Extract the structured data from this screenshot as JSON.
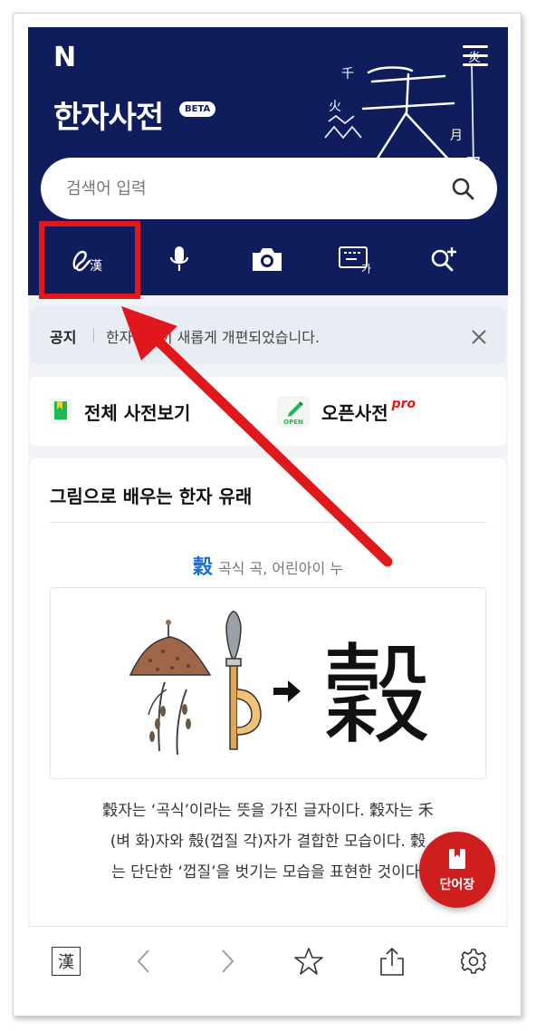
{
  "header": {
    "logo": "N",
    "title": "한자사전",
    "beta": "BETA"
  },
  "search": {
    "placeholder": "검색어 입력"
  },
  "tools": [
    "handwriting-hanja",
    "voice",
    "camera",
    "keyboard-hanja",
    "advanced-search"
  ],
  "tool_hanja_glyph": "漢",
  "tool_keyboard_glyph": "가",
  "notice": {
    "label": "공지",
    "text": "한자사전이 새롭게 개편되었습니다."
  },
  "links": {
    "all_dict": "전체 사전보기",
    "open_dict": "오픈사전",
    "pro": "pro",
    "open_badge": "OPEN"
  },
  "card": {
    "title": "그림으로 배우는 한자 유래",
    "char": "穀",
    "char_meaning": "곡식 곡, 어린아이 누",
    "big_char": "穀",
    "desc_lines": [
      "穀자는 ‘곡식’이라는 뜻을 가진 글자이다. 穀자는 禾",
      "(벼 화)자와 殼(껍질 각)자가 결합한 모습이다. 穀",
      "는 단단한 ‘껍질’을 벗기는 모습을 표현한 것이다."
    ]
  },
  "fab": {
    "label": "단어장"
  },
  "bottom": {
    "hanja": "漢"
  },
  "colors": {
    "header_bg": "#0f1d5c",
    "highlight": "#e0181c",
    "accent_blue": "#1b6fd1",
    "fab": "#cf1e1e"
  }
}
